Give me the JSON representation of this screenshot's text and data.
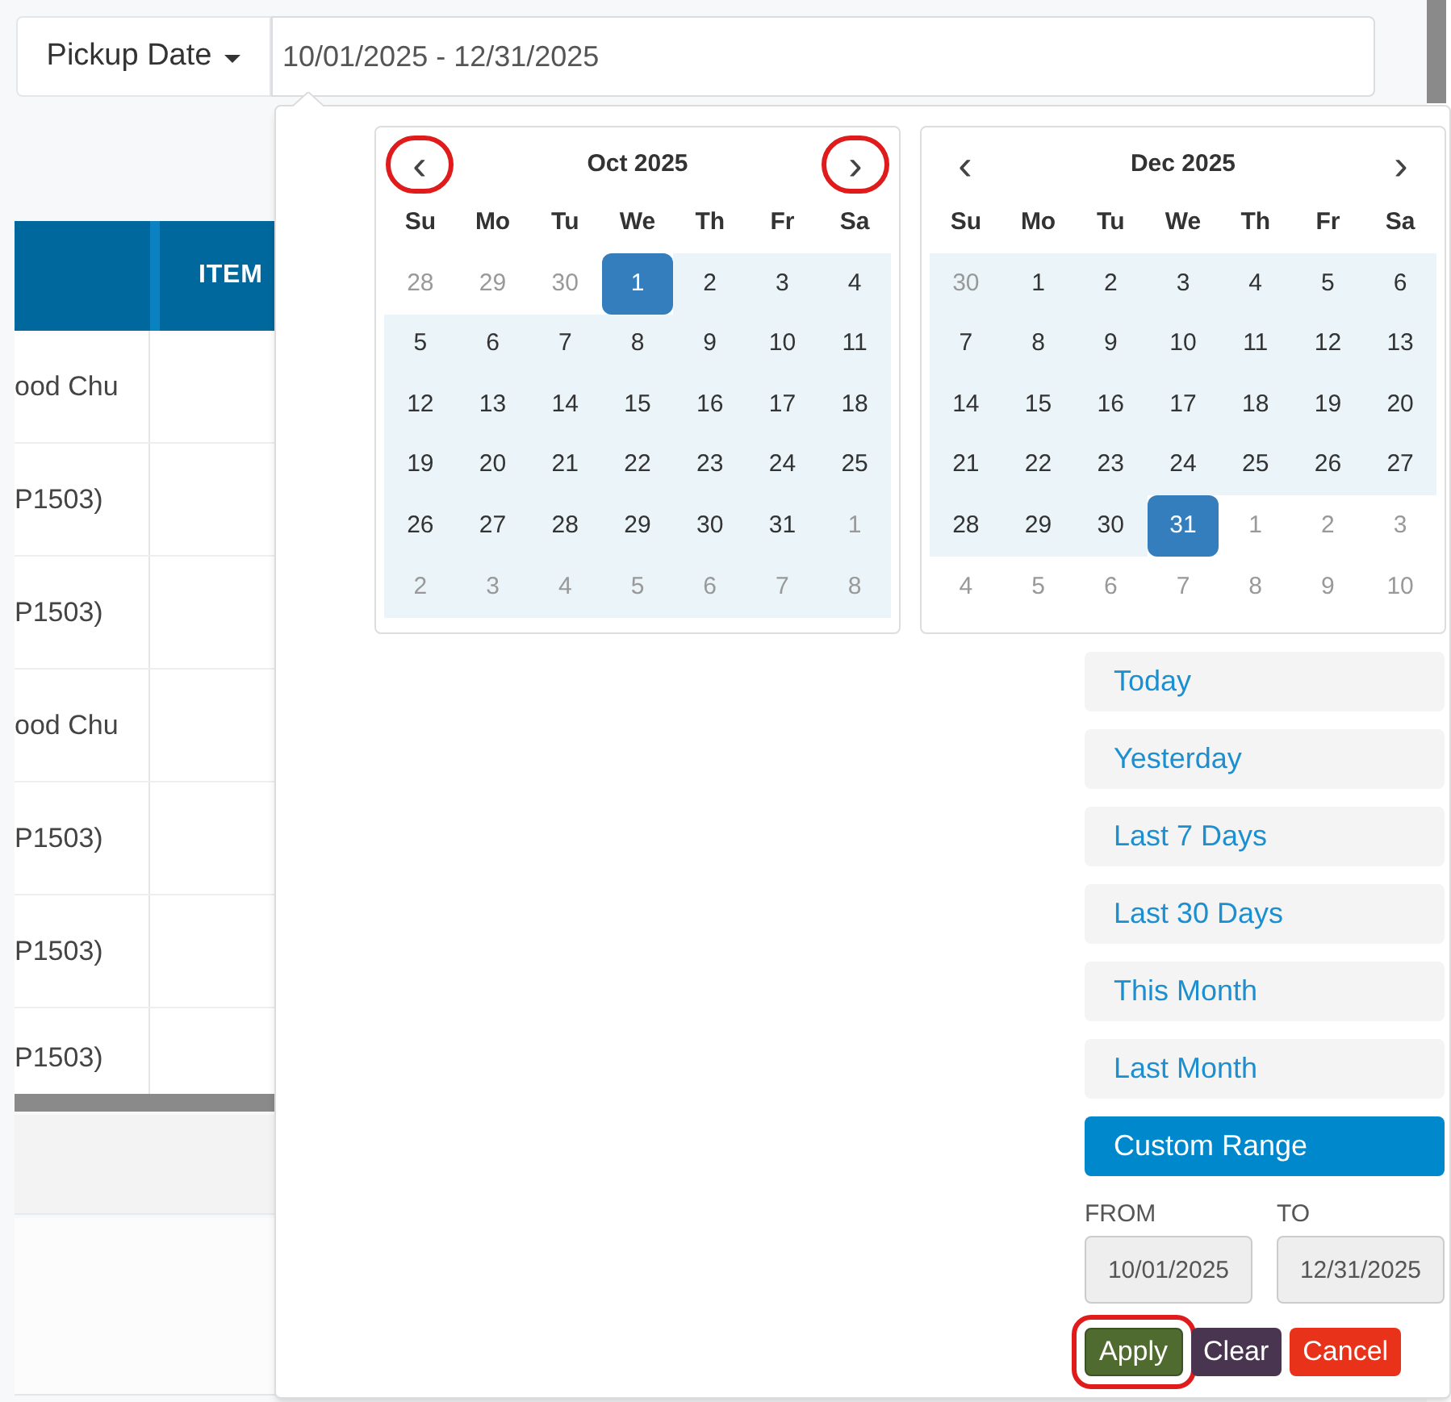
{
  "filter": {
    "label": "Pickup Date",
    "value": "10/01/2025 - 12/31/2025"
  },
  "table": {
    "header": [
      {
        "label": "ITEM"
      }
    ],
    "rows": [
      {
        "cell": "ood Chu"
      },
      {
        "cell": "P1503)"
      },
      {
        "cell": "P1503)"
      },
      {
        "cell": "ood Chu"
      },
      {
        "cell": "P1503)"
      },
      {
        "cell": "P1503)"
      },
      {
        "cell": "P1503)"
      }
    ]
  },
  "calendars": [
    {
      "title": "Oct 2025",
      "prev": {
        "label": "‹",
        "highlighted": true
      },
      "next": {
        "label": "›",
        "highlighted": true
      },
      "weekdays": [
        "Su",
        "Mo",
        "Tu",
        "We",
        "Th",
        "Fr",
        "Sa"
      ],
      "weeks": [
        [
          {
            "day": "28",
            "outside": true,
            "in_range": false,
            "selected": false
          },
          {
            "day": "29",
            "outside": true,
            "in_range": false,
            "selected": false
          },
          {
            "day": "30",
            "outside": true,
            "in_range": false,
            "selected": false
          },
          {
            "day": "1",
            "selected": true
          },
          {
            "day": "2",
            "outside": false,
            "in_range": true,
            "selected": false
          },
          {
            "day": "3",
            "outside": false,
            "in_range": true,
            "selected": false
          },
          {
            "day": "4",
            "outside": false,
            "in_range": true,
            "selected": false
          }
        ],
        [
          {
            "day": "5",
            "outside": false,
            "in_range": true,
            "selected": false
          },
          {
            "day": "6",
            "outside": false,
            "in_range": true,
            "selected": false
          },
          {
            "day": "7",
            "outside": false,
            "in_range": true,
            "selected": false
          },
          {
            "day": "8",
            "outside": false,
            "in_range": true,
            "selected": false
          },
          {
            "day": "9",
            "outside": false,
            "in_range": true,
            "selected": false
          },
          {
            "day": "10",
            "outside": false,
            "in_range": true,
            "selected": false
          },
          {
            "day": "11",
            "outside": false,
            "in_range": true,
            "selected": false
          }
        ],
        [
          {
            "day": "12",
            "outside": false,
            "in_range": true,
            "selected": false
          },
          {
            "day": "13",
            "outside": false,
            "in_range": true,
            "selected": false
          },
          {
            "day": "14",
            "outside": false,
            "in_range": true,
            "selected": false
          },
          {
            "day": "15",
            "outside": false,
            "in_range": true,
            "selected": false
          },
          {
            "day": "16",
            "outside": false,
            "in_range": true,
            "selected": false
          },
          {
            "day": "17",
            "outside": false,
            "in_range": true,
            "selected": false
          },
          {
            "day": "18",
            "outside": false,
            "in_range": true,
            "selected": false
          }
        ],
        [
          {
            "day": "19",
            "outside": false,
            "in_range": true,
            "selected": false
          },
          {
            "day": "20",
            "outside": false,
            "in_range": true,
            "selected": false
          },
          {
            "day": "21",
            "outside": false,
            "in_range": true,
            "selected": false
          },
          {
            "day": "22",
            "outside": false,
            "in_range": true,
            "selected": false
          },
          {
            "day": "23",
            "outside": false,
            "in_range": true,
            "selected": false
          },
          {
            "day": "24",
            "outside": false,
            "in_range": true,
            "selected": false
          },
          {
            "day": "25",
            "outside": false,
            "in_range": true,
            "selected": false
          }
        ],
        [
          {
            "day": "26",
            "outside": false,
            "in_range": true,
            "selected": false
          },
          {
            "day": "27",
            "outside": false,
            "in_range": true,
            "selected": false
          },
          {
            "day": "28",
            "outside": false,
            "in_range": true,
            "selected": false
          },
          {
            "day": "29",
            "outside": false,
            "in_range": true,
            "selected": false
          },
          {
            "day": "30",
            "outside": false,
            "in_range": true,
            "selected": false
          },
          {
            "day": "31",
            "outside": false,
            "in_range": true,
            "selected": false
          },
          {
            "day": "1",
            "outside": true,
            "in_range": true,
            "selected": false
          }
        ],
        [
          {
            "day": "2",
            "outside": true,
            "in_range": true,
            "selected": false
          },
          {
            "day": "3",
            "outside": true,
            "in_range": true,
            "selected": false
          },
          {
            "day": "4",
            "outside": true,
            "in_range": true,
            "selected": false
          },
          {
            "day": "5",
            "outside": true,
            "in_range": true,
            "selected": false
          },
          {
            "day": "6",
            "outside": true,
            "in_range": true,
            "selected": false
          },
          {
            "day": "7",
            "outside": true,
            "in_range": true,
            "selected": false
          },
          {
            "day": "8",
            "outside": true,
            "in_range": true,
            "selected": false
          }
        ]
      ]
    },
    {
      "title": "Dec 2025",
      "prev": {
        "label": "‹",
        "highlighted": false
      },
      "next": {
        "label": "›",
        "highlighted": false
      },
      "weekdays": [
        "Su",
        "Mo",
        "Tu",
        "We",
        "Th",
        "Fr",
        "Sa"
      ],
      "weeks": [
        [
          {
            "day": "30",
            "outside": true,
            "in_range": true,
            "selected": false
          },
          {
            "day": "1",
            "outside": false,
            "in_range": true,
            "selected": false
          },
          {
            "day": "2",
            "outside": false,
            "in_range": true,
            "selected": false
          },
          {
            "day": "3",
            "outside": false,
            "in_range": true,
            "selected": false
          },
          {
            "day": "4",
            "outside": false,
            "in_range": true,
            "selected": false
          },
          {
            "day": "5",
            "outside": false,
            "in_range": true,
            "selected": false
          },
          {
            "day": "6",
            "outside": false,
            "in_range": true,
            "selected": false
          }
        ],
        [
          {
            "day": "7",
            "outside": false,
            "in_range": true,
            "selected": false
          },
          {
            "day": "8",
            "outside": false,
            "in_range": true,
            "selected": false
          },
          {
            "day": "9",
            "outside": false,
            "in_range": true,
            "selected": false
          },
          {
            "day": "10",
            "outside": false,
            "in_range": true,
            "selected": false
          },
          {
            "day": "11",
            "outside": false,
            "in_range": true,
            "selected": false
          },
          {
            "day": "12",
            "outside": false,
            "in_range": true,
            "selected": false
          },
          {
            "day": "13",
            "outside": false,
            "in_range": true,
            "selected": false
          }
        ],
        [
          {
            "day": "14",
            "outside": false,
            "in_range": true,
            "selected": false
          },
          {
            "day": "15",
            "outside": false,
            "in_range": true,
            "selected": false
          },
          {
            "day": "16",
            "outside": false,
            "in_range": true,
            "selected": false
          },
          {
            "day": "17",
            "outside": false,
            "in_range": true,
            "selected": false
          },
          {
            "day": "18",
            "outside": false,
            "in_range": true,
            "selected": false
          },
          {
            "day": "19",
            "outside": false,
            "in_range": true,
            "selected": false
          },
          {
            "day": "20",
            "outside": false,
            "in_range": true,
            "selected": false
          }
        ],
        [
          {
            "day": "21",
            "outside": false,
            "in_range": true,
            "selected": false
          },
          {
            "day": "22",
            "outside": false,
            "in_range": true,
            "selected": false
          },
          {
            "day": "23",
            "outside": false,
            "in_range": true,
            "selected": false
          },
          {
            "day": "24",
            "outside": false,
            "in_range": true,
            "selected": false
          },
          {
            "day": "25",
            "outside": false,
            "in_range": true,
            "selected": false
          },
          {
            "day": "26",
            "outside": false,
            "in_range": true,
            "selected": false
          },
          {
            "day": "27",
            "outside": false,
            "in_range": true,
            "selected": false
          }
        ],
        [
          {
            "day": "28",
            "outside": false,
            "in_range": true,
            "selected": false
          },
          {
            "day": "29",
            "outside": false,
            "in_range": true,
            "selected": false
          },
          {
            "day": "30",
            "outside": false,
            "in_range": true,
            "selected": false
          },
          {
            "day": "31",
            "selected": true
          },
          {
            "day": "1",
            "outside": true,
            "in_range": false,
            "selected": false
          },
          {
            "day": "2",
            "outside": true,
            "in_range": false,
            "selected": false
          },
          {
            "day": "3",
            "outside": true,
            "in_range": false,
            "selected": false
          }
        ],
        [
          {
            "day": "4",
            "outside": true,
            "in_range": false,
            "selected": false
          },
          {
            "day": "5",
            "outside": true,
            "in_range": false,
            "selected": false
          },
          {
            "day": "6",
            "outside": true,
            "in_range": false,
            "selected": false
          },
          {
            "day": "7",
            "outside": true,
            "in_range": false,
            "selected": false
          },
          {
            "day": "8",
            "outside": true,
            "in_range": false,
            "selected": false
          },
          {
            "day": "9",
            "outside": true,
            "in_range": false,
            "selected": false
          },
          {
            "day": "10",
            "outside": true,
            "in_range": false,
            "selected": false
          }
        ]
      ]
    }
  ],
  "ranges": [
    {
      "label": "Today",
      "selected": false
    },
    {
      "label": "Yesterday",
      "selected": false
    },
    {
      "label": "Last 7 Days",
      "selected": false
    },
    {
      "label": "Last 30 Days",
      "selected": false
    },
    {
      "label": "This Month",
      "selected": false
    },
    {
      "label": "Last Month",
      "selected": false
    },
    {
      "label": "Custom Range",
      "selected": true
    }
  ],
  "from": {
    "label": "FROM",
    "value": "10/01/2025"
  },
  "to": {
    "label": "TO",
    "value": "12/31/2025"
  },
  "buttons": [
    {
      "label": "Apply",
      "kind": "apply",
      "highlighted": true
    },
    {
      "label": "Clear",
      "kind": "clear",
      "highlighted": false
    },
    {
      "label": "Cancel",
      "kind": "cancel",
      "highlighted": false
    }
  ]
}
